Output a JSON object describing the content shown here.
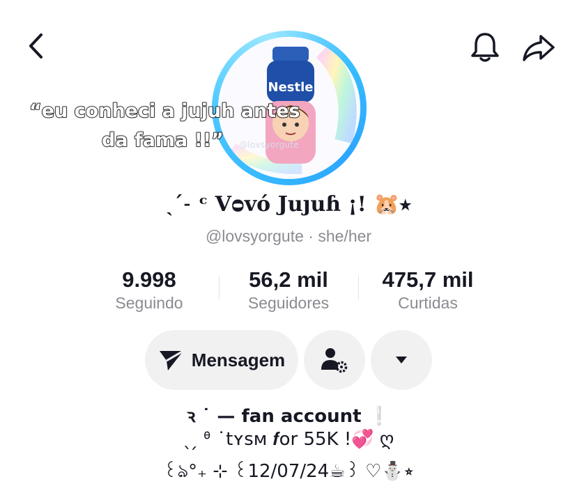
{
  "header": {
    "back_icon": "chevron-left-icon",
    "notifications_icon": "bell-icon",
    "share_icon": "share-arrow-icon"
  },
  "avatar": {
    "ring_color": "#36b8ff",
    "watermark": "@lovsyorgute",
    "bottle_text": "Nestle"
  },
  "overlay": {
    "quote_line_1": "“eu conheci a jujuh antes",
    "quote_line_2": "da fama !!”"
  },
  "profile": {
    "display_name": "ˎˊ˗ ᶜ Vᴑvó Juȷuɦ ¡! 🐹⭒",
    "handle_line": "@lovsyorgute · she/her"
  },
  "stats": {
    "following_value": "9.998",
    "following_label": "Seguindo",
    "followers_value": "56,2 mil",
    "followers_label": "Seguidores",
    "likes_value": "475,7 mil",
    "likes_label": "Curtidas"
  },
  "actions": {
    "message_label": "Mensagem",
    "message_icon": "send-icon",
    "follow_settings_icon": "user-gear-icon",
    "more_icon": "caret-down-icon"
  },
  "bio": {
    "line_1": "ꝛ ˙ — fan account ❕",
    "line_2": "ˎ ̗ ᶿ ˙tʏsᴍ 𝒇ᴏr 55K !💞 ღ",
    "line_3": "꒰ঌ°₊ ⊹ ꒰12/07/24☕꒱ ♡⛄⭒"
  },
  "colors": {
    "text_primary": "#161823",
    "text_secondary": "#8a8b91",
    "button_bg": "#f1f1f2"
  }
}
